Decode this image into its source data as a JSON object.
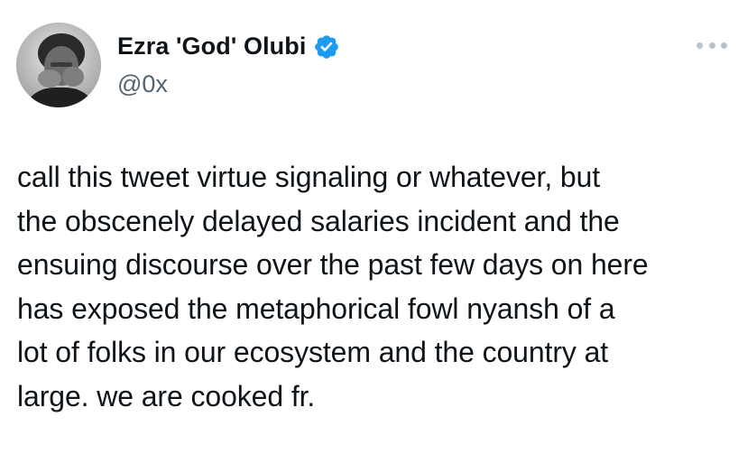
{
  "tweet": {
    "author": {
      "display_name": "Ezra 'God' Olubi",
      "handle": "@0x",
      "avatar_icon": "profile-photo",
      "verified_icon": "verified-badge-icon",
      "verified_color": "#1d9bf0"
    },
    "more_icon": "more-options-icon",
    "body_lines": [
      "call this tweet virtue signaling or whatever, but",
      "the obscenely delayed salaries incident and the",
      "ensuing discourse over the past few days on here",
      "has exposed the metaphorical fowl nyansh of a",
      "lot of folks in our ecosystem and the country at",
      "large. we are cooked fr."
    ]
  }
}
